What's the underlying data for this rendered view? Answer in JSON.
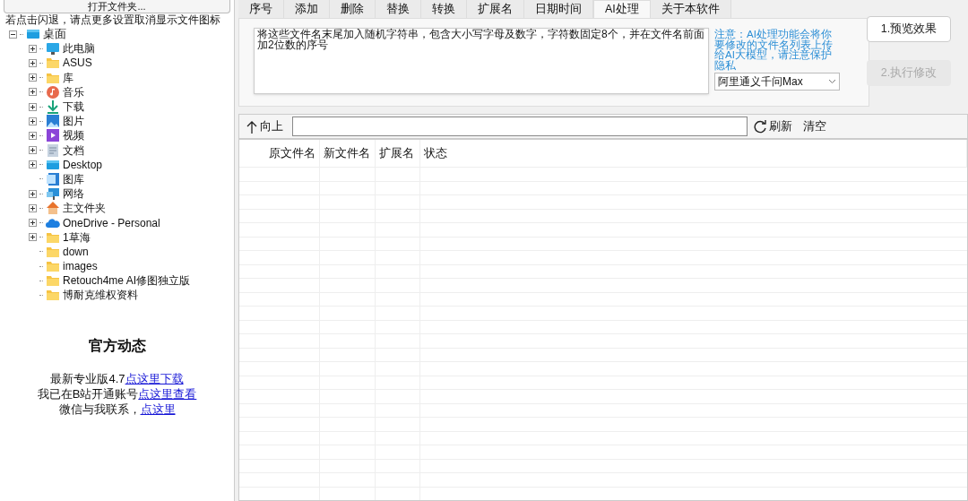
{
  "open_folder_button": "打开文件夹...",
  "hint": "若点击闪退，请点更多设置取消显示文件图标",
  "tree": [
    {
      "label": "桌面",
      "kind": "desktop",
      "has_children": true,
      "expanded": true,
      "children": [
        {
          "label": "此电脑",
          "kind": "monitor",
          "has_children": true
        },
        {
          "label": "ASUS",
          "kind": "folder",
          "has_children": true
        },
        {
          "label": "库",
          "kind": "folder",
          "has_children": true
        },
        {
          "label": "音乐",
          "kind": "music",
          "has_children": true
        },
        {
          "label": "下载",
          "kind": "download",
          "has_children": true
        },
        {
          "label": "图片",
          "kind": "image",
          "has_children": true
        },
        {
          "label": "视频",
          "kind": "video",
          "has_children": true
        },
        {
          "label": "文档",
          "kind": "document",
          "has_children": true
        },
        {
          "label": "Desktop",
          "kind": "desktop",
          "has_children": true
        },
        {
          "label": "图库",
          "kind": "gallery",
          "has_children": false
        },
        {
          "label": "网络",
          "kind": "network",
          "has_children": true
        },
        {
          "label": "主文件夹",
          "kind": "home",
          "has_children": true
        },
        {
          "label": "OneDrive - Personal",
          "kind": "cloud",
          "has_children": true
        },
        {
          "label": "1草海",
          "kind": "folder",
          "has_children": true
        },
        {
          "label": "down",
          "kind": "folder",
          "has_children": false
        },
        {
          "label": "images",
          "kind": "folder",
          "has_children": false
        },
        {
          "label": "Retouch4me AI修图独立版",
          "kind": "folder",
          "has_children": false
        },
        {
          "label": "博耐克维权资料",
          "kind": "folder",
          "has_children": false
        }
      ]
    }
  ],
  "news": {
    "title": "官方动态",
    "lines": [
      {
        "text": "最新专业版4.7",
        "link": "点这里下载"
      },
      {
        "text": "我已在B站开通账号",
        "link": "点这里查看"
      },
      {
        "text": "微信与我联系，",
        "link": "点这里"
      }
    ]
  },
  "tabs": [
    {
      "label": "序号",
      "selected": false
    },
    {
      "label": "添加",
      "selected": false
    },
    {
      "label": "删除",
      "selected": false
    },
    {
      "label": "替换",
      "selected": false
    },
    {
      "label": "转换",
      "selected": false
    },
    {
      "label": "扩展名",
      "selected": false
    },
    {
      "label": "日期时间",
      "selected": false
    },
    {
      "label": "AI处理",
      "selected": true
    },
    {
      "label": "关于本软件",
      "selected": false
    }
  ],
  "prompt": "将这些文件名末尾加入随机字符串，包含大小写字母及数字，字符数固定8个，并在文件名前面加2位数的序号",
  "notice": "注意：AI处理功能会将你要修改的文件名列表上传给AI大模型，请注意保护隐私",
  "model_select": "阿里通义千问Max",
  "buttons": [
    {
      "label": "1.预览效果",
      "disabled": false
    },
    {
      "label": "2.执行修改",
      "disabled": true
    }
  ],
  "toolbar": {
    "up": "向上",
    "refresh": "刷新",
    "clear": "清空"
  },
  "table": {
    "columns": [
      "原文件名",
      "新文件名",
      "扩展名",
      "状态"
    ]
  }
}
